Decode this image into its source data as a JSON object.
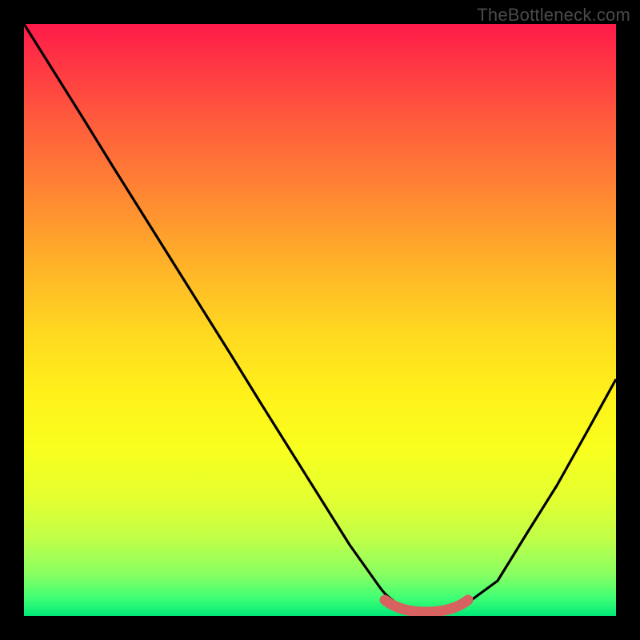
{
  "watermark": "TheBottleneck.com",
  "colors": {
    "background": "#000000",
    "curve_main": "#000000",
    "curve_accent": "#d8625f",
    "gradient_top": "#ff1a4a",
    "gradient_bottom": "#00e878"
  },
  "chart_data": {
    "type": "line",
    "title": "",
    "xlabel": "",
    "ylabel": "",
    "xlim": [
      0,
      100
    ],
    "ylim": [
      0,
      100
    ],
    "grid": false,
    "legend": false,
    "series": [
      {
        "name": "bottleneck-curve",
        "x": [
          0,
          5,
          10,
          15,
          20,
          25,
          30,
          35,
          40,
          45,
          50,
          55,
          60,
          62,
          66,
          70,
          74,
          76,
          80,
          85,
          90,
          95,
          100
        ],
        "values": [
          100,
          92,
          84,
          76,
          68,
          60,
          52,
          44,
          36,
          28,
          20,
          12,
          5,
          2,
          1,
          1,
          1,
          2,
          6,
          14,
          22,
          31,
          40
        ]
      },
      {
        "name": "sweet-spot-segment",
        "x": [
          61,
          64,
          68,
          72,
          75
        ],
        "values": [
          2.0,
          0.8,
          0.6,
          0.8,
          2.0
        ]
      }
    ],
    "annotations": []
  }
}
